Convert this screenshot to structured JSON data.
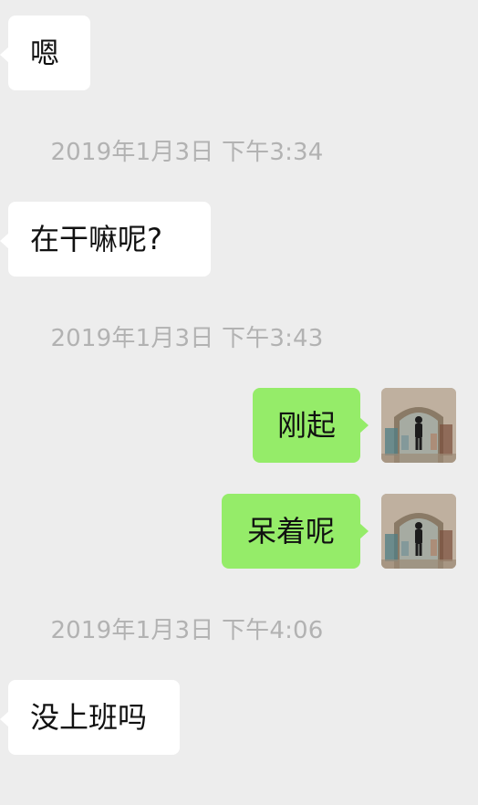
{
  "conversation": {
    "messages": [
      {
        "type": "incoming",
        "text": "嗯"
      },
      {
        "type": "timestamp",
        "text": "2019年1月3日  下午3:34"
      },
      {
        "type": "incoming",
        "text": "在干嘛呢?"
      },
      {
        "type": "timestamp",
        "text": "2019年1月3日  下午3:43"
      },
      {
        "type": "outgoing",
        "text": "刚起",
        "avatar_icon": "user-avatar-icon"
      },
      {
        "type": "outgoing",
        "text": "呆着呢",
        "avatar_icon": "user-avatar-icon"
      },
      {
        "type": "timestamp",
        "text": "2019年1月3日  下午4:06"
      },
      {
        "type": "incoming",
        "text": "没上班吗"
      }
    ]
  },
  "colors": {
    "background": "#ededed",
    "incoming_bubble": "#ffffff",
    "outgoing_bubble": "#95ec69",
    "timestamp_text": "#b2b2b2",
    "message_text": "#111111"
  }
}
